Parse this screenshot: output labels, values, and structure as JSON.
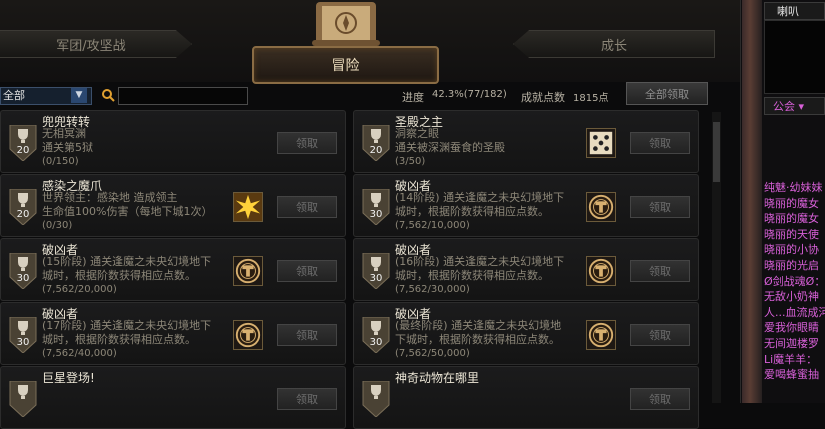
{
  "header": {
    "tab_left": "军团/攻坚战",
    "tab_center": "冒险",
    "tab_right": "成长"
  },
  "filter": {
    "selected": "全部"
  },
  "progress": {
    "label": "进度",
    "value": "42.3%(77/182)"
  },
  "points": {
    "label": "成就点数",
    "value": "1815点"
  },
  "claim_all_label": "全部领取",
  "cards": [
    {
      "title": "兜兜转转",
      "desc1": "无相冥渊",
      "desc2": "通关第5狱",
      "count": "(0/150)",
      "trophy": "20",
      "icon": "",
      "claim": "领取"
    },
    {
      "title": "圣殿之主",
      "desc1": "洞察之眼",
      "desc2": "通关被深渊蚕食的圣殿",
      "count": "(3/50)",
      "trophy": "20",
      "icon": "dice-icon",
      "claim": "领取"
    },
    {
      "title": "感染之魔爪",
      "desc1": "世界领主：感染地    造成领主",
      "desc2": "生命值100%伤害（每地下城1次）",
      "count": "(0/30)",
      "trophy": "20",
      "icon": "burst-icon",
      "claim": "领取"
    },
    {
      "title": "破凶者",
      "desc1": "(14阶段) 通关逢魔之未央幻境地下",
      "desc2": "城时，根据阶数获得相应点数。",
      "count": "(7,562/10,000)",
      "trophy": "30",
      "icon": "emblem-icon",
      "claim": "领取"
    },
    {
      "title": "破凶者",
      "desc1": "(15阶段) 通关逢魔之未央幻境地下",
      "desc2": "城时，根据阶数获得相应点数。",
      "count": "(7,562/20,000)",
      "trophy": "30",
      "icon": "emblem-icon",
      "claim": "领取"
    },
    {
      "title": "破凶者",
      "desc1": "(16阶段) 通关逢魔之未央幻境地下",
      "desc2": "城时，根据阶数获得相应点数。",
      "count": "(7,562/30,000)",
      "trophy": "30",
      "icon": "emblem-icon",
      "claim": "领取"
    },
    {
      "title": "破凶者",
      "desc1": "(17阶段) 通关逢魔之未央幻境地下",
      "desc2": "城时，根据阶数获得相应点数。",
      "count": "(7,562/40,000)",
      "trophy": "30",
      "icon": "emblem-icon",
      "claim": "领取"
    },
    {
      "title": "破凶者",
      "desc1": "(最终阶段) 通关逢魔之未央幻境地",
      "desc2": "下城时，根据阶数获得相应点数。",
      "count": "(7,562/50,000)",
      "trophy": "30",
      "icon": "emblem-icon",
      "claim": "领取"
    },
    {
      "title": "巨星登场!",
      "desc1": "",
      "desc2": "",
      "count": "",
      "trophy": "",
      "icon": "",
      "claim": "领取"
    },
    {
      "title": "神奇动物在哪里",
      "desc1": "",
      "desc2": "",
      "count": "",
      "trophy": "",
      "icon": "",
      "claim": "领取"
    }
  ],
  "right_panel": {
    "horn_label": "喇叭",
    "guild_label": "公会",
    "chat_lines": [
      {
        "text": "纯魅·幼妹妹",
        "color": "#d860d8"
      },
      {
        "text": "晓丽的魔女",
        "color": "#d860d8"
      },
      {
        "text": "晓丽的魔女",
        "color": "#d860d8"
      },
      {
        "text": "晓丽的天使",
        "color": "#d860d8"
      },
      {
        "text": "晓丽的小协",
        "color": "#d860d8"
      },
      {
        "text": "晓丽的光启",
        "color": "#d860d8"
      },
      {
        "text": "Ø剑战魂Ø：",
        "color": "#d860d8"
      },
      {
        "text": "无敌小奶神",
        "color": "#d860d8"
      },
      {
        "text": "人...血流成河",
        "color": "#d860d8"
      },
      {
        "text": "爱我你眼睛",
        "color": "#d860d8"
      },
      {
        "text": "无间迦楼罗",
        "color": "#d860d8"
      },
      {
        "text": "Li魔羊羊：",
        "color": "#d860d8"
      },
      {
        "text": "爱喝蜂蜜抽",
        "color": "#d860d8"
      }
    ]
  }
}
